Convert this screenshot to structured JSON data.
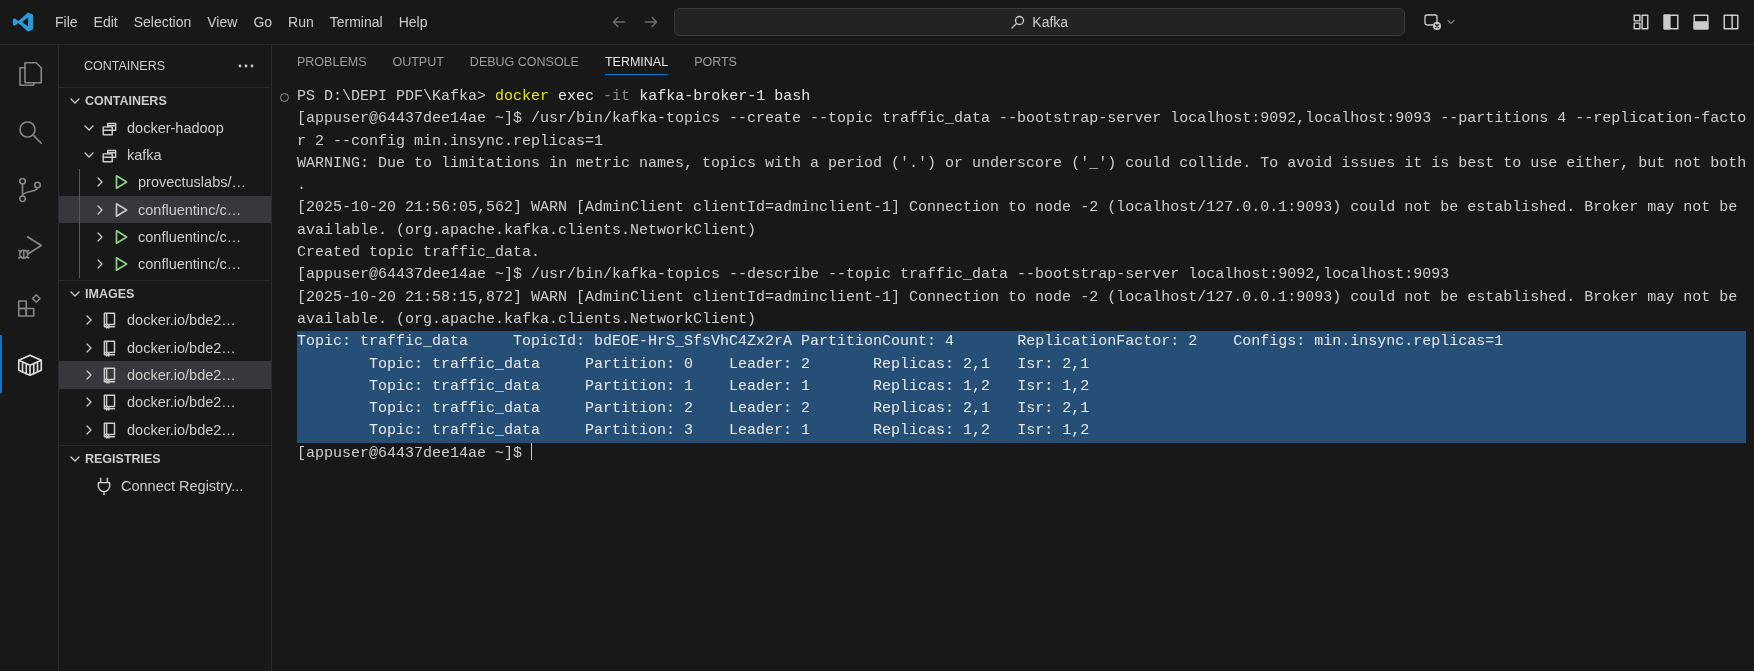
{
  "title_bar": {
    "menu": [
      "File",
      "Edit",
      "Selection",
      "View",
      "Go",
      "Run",
      "Terminal",
      "Help"
    ],
    "search": {
      "value": "Kafka"
    }
  },
  "activity_bar": {
    "items": [
      {
        "kind": "explorer",
        "selected": false
      },
      {
        "kind": "search",
        "selected": false
      },
      {
        "kind": "source-control",
        "selected": false
      },
      {
        "kind": "run-debug",
        "selected": false
      },
      {
        "kind": "extensions",
        "selected": false
      },
      {
        "kind": "docker",
        "selected": true
      }
    ]
  },
  "sidebar": {
    "title": "CONTAINERS",
    "sections": [
      {
        "title": "CONTAINERS",
        "expanded": true,
        "items": [
          {
            "kind": "group",
            "label": "docker-hadoop",
            "expanded": true,
            "selected": false
          },
          {
            "kind": "group",
            "label": "kafka",
            "expanded": true,
            "selected": false,
            "children": [
              {
                "kind": "container",
                "label": "provectuslabs/…",
                "running": true,
                "expanded": false,
                "selected": false
              },
              {
                "kind": "container",
                "label": "confluentinc/c…",
                "running": false,
                "expanded": false,
                "selected": true
              },
              {
                "kind": "container",
                "label": "confluentinc/c…",
                "running": true,
                "expanded": false,
                "selected": false
              },
              {
                "kind": "container",
                "label": "confluentinc/c…",
                "running": true,
                "expanded": false,
                "selected": false
              }
            ]
          }
        ]
      },
      {
        "title": "IMAGES",
        "expanded": true,
        "items": [
          {
            "kind": "image",
            "label": "docker.io/bde2…",
            "expanded": false,
            "selected": false
          },
          {
            "kind": "image",
            "label": "docker.io/bde2…",
            "expanded": false,
            "selected": false
          },
          {
            "kind": "image",
            "label": "docker.io/bde2…",
            "expanded": false,
            "selected": true
          },
          {
            "kind": "image",
            "label": "docker.io/bde2…",
            "expanded": false,
            "selected": false
          },
          {
            "kind": "image",
            "label": "docker.io/bde2…",
            "expanded": false,
            "selected": false
          }
        ]
      },
      {
        "title": "REGISTRIES",
        "expanded": true,
        "items": [
          {
            "kind": "connect",
            "label": "Connect Registry...",
            "selected": false
          }
        ]
      }
    ]
  },
  "panel": {
    "tabs": [
      {
        "label": "PROBLEMS",
        "selected": false
      },
      {
        "label": "OUTPUT",
        "selected": false
      },
      {
        "label": "DEBUG CONSOLE",
        "selected": false
      },
      {
        "label": "TERMINAL",
        "selected": true
      },
      {
        "label": "PORTS",
        "selected": false
      }
    ],
    "terminal": {
      "lines": [
        {
          "kind": "command",
          "prompt": "PS D:\\DEPI PDF\\Kafka>",
          "parts": [
            {
              "text": "docker",
              "kind": "program"
            },
            {
              "text": "exec",
              "kind": "arg"
            },
            {
              "text": "-it",
              "kind": "flag"
            },
            {
              "text": "kafka-broker-1",
              "kind": "arg"
            },
            {
              "text": "bash",
              "kind": "arg"
            }
          ],
          "selected": false
        },
        {
          "kind": "output",
          "text": "[appuser@64437dee14ae ~]$ /usr/bin/kafka-topics --create --topic traffic_data --bootstrap-server localhost:9092,localhost:9093 --partitions 4 --replication-facto",
          "selected": false
        },
        {
          "kind": "output",
          "text": "r 2 --config min.insync.replicas=1",
          "selected": false
        },
        {
          "kind": "output",
          "text": "WARNING: Due to limitations in metric names, topics with a period ('.') or underscore ('_') could collide. To avoid issues it is best to use either, but not both",
          "selected": false
        },
        {
          "kind": "output",
          "text": ".",
          "selected": false
        },
        {
          "kind": "output",
          "text": "[2025-10-20 21:56:05,562] WARN [AdminClient clientId=adminclient-1] Connection to node -2 (localhost/127.0.0.1:9093) could not be established. Broker may not be",
          "selected": false
        },
        {
          "kind": "output",
          "text": "available. (org.apache.kafka.clients.NetworkClient)",
          "selected": false
        },
        {
          "kind": "output",
          "text": "Created topic traffic_data.",
          "selected": false
        },
        {
          "kind": "output",
          "text": "[appuser@64437dee14ae ~]$ /usr/bin/kafka-topics --describe --topic traffic_data --bootstrap-server localhost:9092,localhost:9093",
          "selected": false
        },
        {
          "kind": "output",
          "text": "[2025-10-20 21:58:15,872] WARN [AdminClient clientId=adminclient-1] Connection to node -2 (localhost/127.0.0.1:9093) could not be established. Broker may not be",
          "selected": false
        },
        {
          "kind": "output",
          "text": "available. (org.apache.kafka.clients.NetworkClient)",
          "selected": false
        },
        {
          "kind": "output",
          "text": "Topic: traffic_data\tTopicId: bdEOE-HrS_SfsVhC4Zx2rA PartitionCount: 4\tReplicationFactor: 2\tConfigs: min.insync.replicas=1",
          "selected": true
        },
        {
          "kind": "output",
          "text": "\tTopic: traffic_data\tPartition: 0\tLeader: 2\tReplicas: 2,1\tIsr: 2,1",
          "selected": true
        },
        {
          "kind": "output",
          "text": "\tTopic: traffic_data\tPartition: 1\tLeader: 1\tReplicas: 1,2\tIsr: 1,2",
          "selected": true
        },
        {
          "kind": "output",
          "text": "\tTopic: traffic_data\tPartition: 2\tLeader: 2\tReplicas: 2,1\tIsr: 2,1",
          "selected": true
        },
        {
          "kind": "output",
          "text": "\tTopic: traffic_data\tPartition: 3\tLeader: 1\tReplicas: 1,2\tIsr: 1,2",
          "selected": true
        },
        {
          "kind": "prompt",
          "text": "[appuser@64437dee14ae ~]$",
          "selected": false
        }
      ]
    }
  }
}
